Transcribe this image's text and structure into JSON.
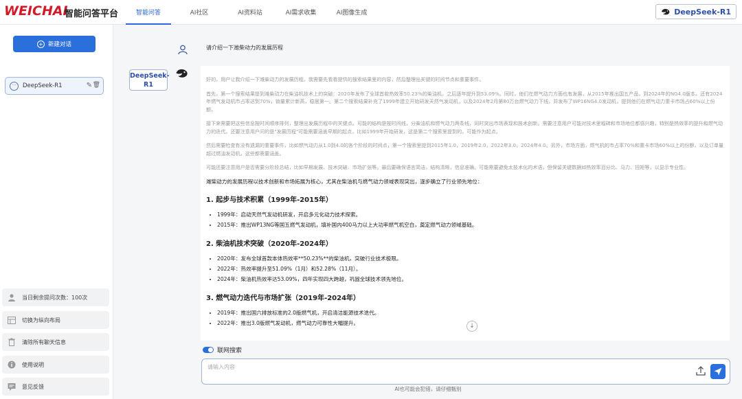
{
  "header": {
    "logo": "WEICHAI",
    "platform": "智能问答平台",
    "tabs": [
      "智能问答",
      "AI社区",
      "AI资料站",
      "AI需求收集",
      "AI图像生成"
    ],
    "active_tab": 0,
    "model_badge": "DeepSeek-R1"
  },
  "sidebar": {
    "new_chat": "新建对话",
    "conversation": "DeepSeek-R1",
    "buttons": [
      {
        "icon": "user-icon",
        "label": "当日剩余提问次数：100次"
      },
      {
        "icon": "layout-icon",
        "label": "切换为纵向布局"
      },
      {
        "icon": "trash-icon",
        "label": "清除所有聊天信息"
      },
      {
        "icon": "info-icon",
        "label": "使用说明"
      },
      {
        "icon": "feedback-icon",
        "label": "意见反馈"
      }
    ]
  },
  "chat": {
    "user_message": "请介绍一下潍柴动力的发展历程",
    "bot_name": "DeepSeek-R1",
    "thinking": [
      "好的，用户让我介绍一下潍柴动力的发展历程。我需要先看看提供的搜索结果里的内容，然后整理出关键的时间节点和重要事件。",
      "首先，第一个搜索结果提到潍柴动力在柴油机技术上的突破：2020年发布了全球首款热效率50.23%的柴油机，之后逐年提升到53.09%。同时，他们在燃气动力方面也有发展，从2015年推出国五产品，到2024年的NG4.0版本。还有2024年燃气发动机市占率达到70%，销量累计新高，稳居第一。第二个搜索结果补充了1999年建立开始研发天然气发动机，以及2024年2月第80万台燃气动力下线，并发布了WP16NG4.0发动机，提到他们在燃气动力重卡市场占60%以上份额。",
      "接下来需要把这些信息按时间顺序排列，整理出发展历程中的关键点。可能的结构是按时间线，分柴油机和燃气动力两条线，同时突出市场表现和技术创新。需要注意用户可能对技术里程碑和市场地位都感兴趣，特别是热效率的提升和燃气动力的迭代。还要注意用户问的是\"发展历程\"可能需要涵盖早期的起点，比如1999年开始研发，这是第二个搜索里提到的，可能作为起点。",
      "然后需要检查有没有遗漏的重要事件，比如燃气动力从1.0到4.0的各个阶段的时间点，第一个搜索里提到2015年1.0，2019年2.0，2022年3.0，2024年4.0。另外，市场方面，燃气机的市占率70%和重卡市场60%以上的份额，以及订单量超过燃油发动机，这些都需要涵盖。",
      "可能还要注意用户是否需要分阶段总结，比如早期发展、技术突破、市场扩张等。最后要确保语言简洁，结构清晰，信息准确。可能需要避免太技术化的术语，但保留关键数据如热效率百分比、马力、扭矩等，以显示专业性。"
    ],
    "intro": "潍柴动力的发展历程以技术创新和市场拓展为核心，尤其在柴油机与燃气动力领域表现突出，逐步确立了行业领先地位：",
    "sections": [
      {
        "heading": "1. 起步与技术积累（1999年-2015年）",
        "items": [
          "1999年：启动天然气发动机研发，开启多元化动力技术探索。",
          "2015年：推出WP13NG等国五燃气发动机，填补国内400马力以上大功率燃气机空白，奠定燃气动力领域基础。"
        ]
      },
      {
        "heading": "2. 柴油机技术突破（2020年-2024年）",
        "items": [
          "2020年：发布全球首款本体热效率**50.23%**的柴油机，突破行业技术极限。",
          "2022年：热效率提升至51.09%（1月）和52.28%（11月）。",
          "2024年：柴油机热效率达53.09%，四年实现四大跨越，巩固全球技术领先地位。"
        ]
      },
      {
        "heading": "3. 燃气动力迭代与市场扩张（2019年-2024年）",
        "items": [
          "2019年：推出国六排放标准的2.0版燃气机，开启清洁能源技术迭代。",
          "2022年：推出3.0版燃气发动机，燃气动力可靠性大幅提升。"
        ]
      }
    ],
    "web_search": "联网搜索",
    "input_placeholder": "请输入内容",
    "disclaimer": "AI也可能会犯错，请仔细甄别"
  },
  "colors": {
    "brand_red": "#d11a2a",
    "accent_blue": "#2b6fdc"
  }
}
